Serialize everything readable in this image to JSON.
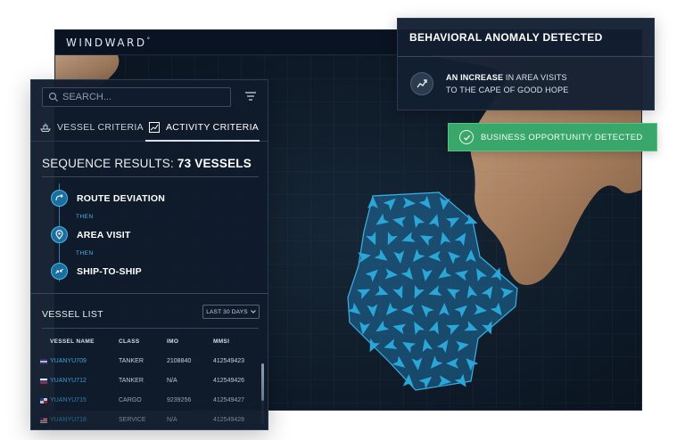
{
  "brand": {
    "name": "WINDWARD",
    "mark": "°"
  },
  "search": {
    "placeholder": "SEARCH..."
  },
  "tabs": [
    {
      "label": "VESSEL CRITERIA",
      "icon": "ship-icon"
    },
    {
      "label": "ACTIVITY CRITERIA",
      "icon": "activity-chart-icon",
      "active": true
    }
  ],
  "results": {
    "prefix": "SEQUENCE RESULTS:",
    "count_text": "73 VESSELS"
  },
  "sequence": {
    "steps": [
      {
        "label": "ROUTE DEVIATION",
        "icon": "route-deviation-icon"
      },
      {
        "label": "AREA VISIT",
        "icon": "map-pin-icon"
      },
      {
        "label": "SHIP-TO-SHIP",
        "icon": "ship-to-ship-icon"
      }
    ],
    "connector": "THEN"
  },
  "vessel_list": {
    "title": "VESSEL LIST",
    "period": "LAST 30 DAYS",
    "columns": [
      "VESSEL NAME",
      "CLASS",
      "IMO",
      "MMSI"
    ],
    "rows": [
      {
        "name": "YUANYU709",
        "class": "TANKER",
        "imo": "2108840",
        "mmsi": "412549423"
      },
      {
        "name": "YUANYU712",
        "class": "TANKER",
        "imo": "N/A",
        "mmsi": "412549426"
      },
      {
        "name": "YUANYU715",
        "class": "CARGO",
        "imo": "9239256",
        "mmsi": "412549427"
      },
      {
        "name": "YUANYU718",
        "class": "SERVICE",
        "imo": "N/A",
        "mmsi": "412549428"
      }
    ]
  },
  "anomaly": {
    "title": "BEHAVIORAL ANOMALY DETECTED",
    "lead": "AN INCREASE",
    "text_rest": " IN AREA VISITS",
    "line2": "TO THE CAPE OF GOOD HOPE",
    "icon": "trend-icon"
  },
  "opportunity": {
    "label": "BUSINESS OPPORTUNITY DETECTED",
    "icon": "check-circle-icon"
  },
  "colors": {
    "accent": "#3fa7dc",
    "panel": "#101b2c",
    "success": "#3aa76a",
    "vessel_marker": "#2aa7d8"
  }
}
